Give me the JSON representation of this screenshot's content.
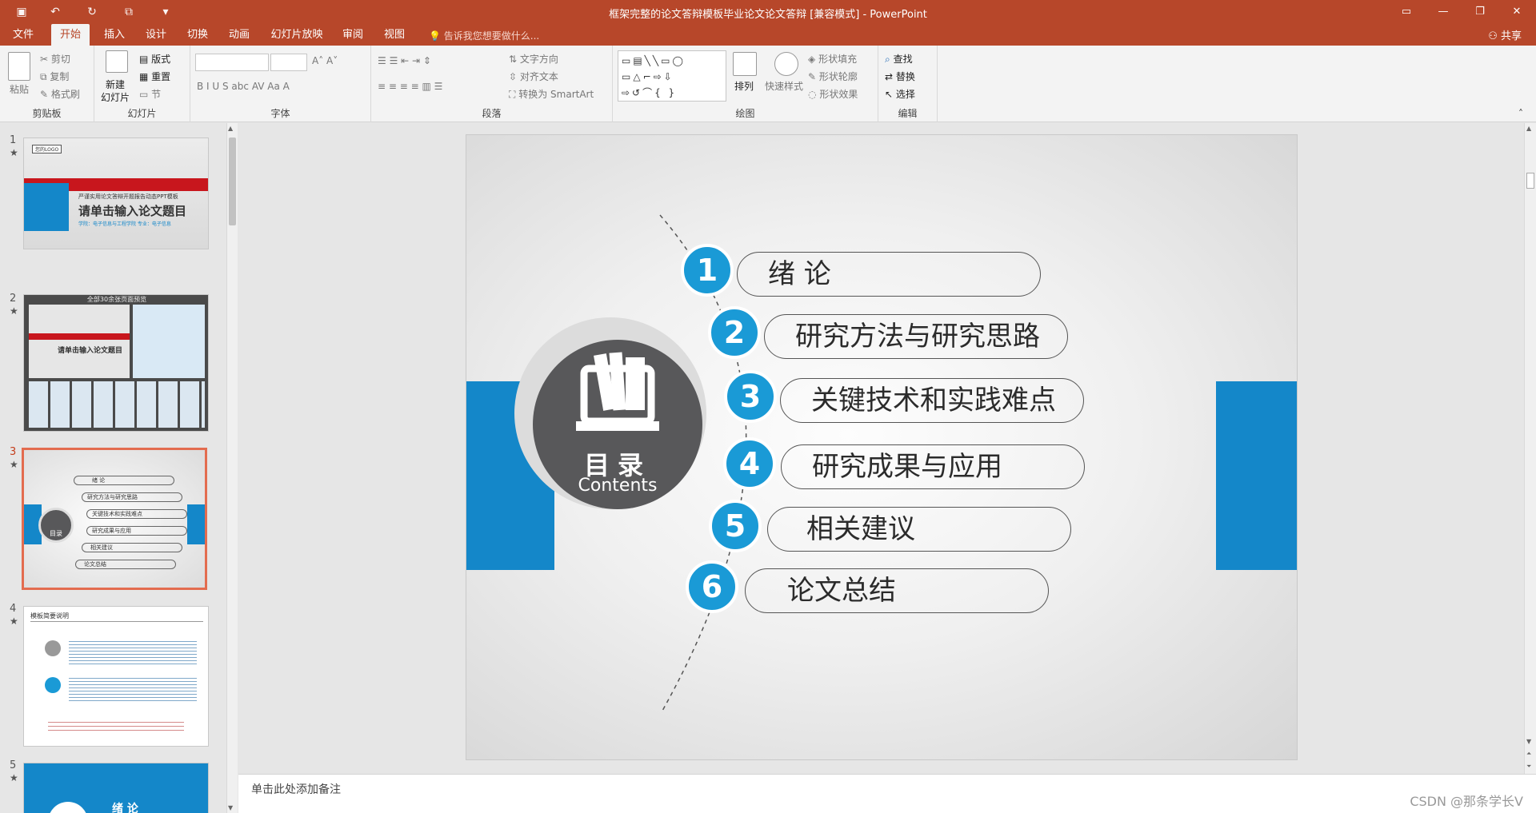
{
  "titlebar": {
    "title": "框架完整的论文答辩模板毕业论文论文答辩 [兼容模式] - PowerPoint",
    "qa_icons": [
      "save-icon",
      "undo-icon",
      "redo-icon",
      "slideshow-icon",
      "customize-icon"
    ],
    "window_buttons": [
      "ribbon-display-icon",
      "minimize-icon",
      "restore-icon",
      "close-icon"
    ]
  },
  "tabs": [
    "文件",
    "开始",
    "插入",
    "设计",
    "切换",
    "动画",
    "幻灯片放映",
    "审阅",
    "视图"
  ],
  "active_tab": "开始",
  "tell_me": "告诉我您想要做什么...",
  "share": "共享",
  "ribbon": {
    "clipboard": {
      "label": "剪贴板",
      "paste": "粘贴",
      "cut": "剪切",
      "copy": "复制",
      "format_painter": "格式刷"
    },
    "slides": {
      "label": "幻灯片",
      "new_slide_1": "新建",
      "new_slide_2": "幻灯片",
      "layout": "版式",
      "reset": "重置",
      "section": "节"
    },
    "font": {
      "label": "字体",
      "buttons": "B  I  U  S  abc  AV  Aa  A"
    },
    "paragraph": {
      "label": "段落",
      "text_direction": "文字方向",
      "align_text": "对齐文本",
      "smartart": "转换为 SmartArt"
    },
    "drawing": {
      "label": "绘图",
      "arrange": "排列",
      "quick_styles": "快速样式",
      "shape_fill": "形状填充",
      "shape_outline": "形状轮廓",
      "shape_effects": "形状效果",
      "shapes_row1": "▭▤╲╲▭◯",
      "shapes_row2": "▭△⌐⇨⇩",
      "shapes_row3": "⇨↺⌒{ }"
    },
    "editing": {
      "label": "编辑",
      "find": "查找",
      "replace": "替换",
      "select": "选择"
    }
  },
  "thumbnails": [
    {
      "num": "1",
      "star": "★",
      "title": "请单击输入论文题目",
      "logo": "您的LOGO",
      "subtitle": "严谨实用论文答辩开题报告动态PPT模板",
      "info": "学院：电子信息与工程学院   专业：电子信息"
    },
    {
      "num": "2",
      "star": "★",
      "header": "全部30余张页面预览",
      "title": "请单击输入论文题目"
    },
    {
      "num": "3",
      "star": "★",
      "items": [
        "绪    论",
        "研究方法与研究思路",
        "关键技术和实践难点",
        "研究成果与应用",
        "相关建议",
        "论文总结"
      ],
      "center": "目录"
    },
    {
      "num": "4",
      "star": "★",
      "header": "模板简要说明"
    },
    {
      "num": "5",
      "star": "★",
      "title": "绪 论"
    }
  ],
  "slide": {
    "center_title": "目录",
    "center_subtitle": "Contents",
    "items": [
      {
        "num": "1",
        "label": "绪    论"
      },
      {
        "num": "2",
        "label": "研究方法与研究思路"
      },
      {
        "num": "3",
        "label": "关键技术和实践难点"
      },
      {
        "num": "4",
        "label": "研究成果与应用"
      },
      {
        "num": "5",
        "label": "相关建议"
      },
      {
        "num": "6",
        "label": "论文总结"
      }
    ]
  },
  "notes_placeholder": "单击此处添加备注",
  "watermark": "CSDN @那条学长V",
  "colors": {
    "accent": "#b7472a",
    "blue": "#1a9ad6",
    "band": "#1487c9",
    "dark_circle": "#58585a"
  }
}
